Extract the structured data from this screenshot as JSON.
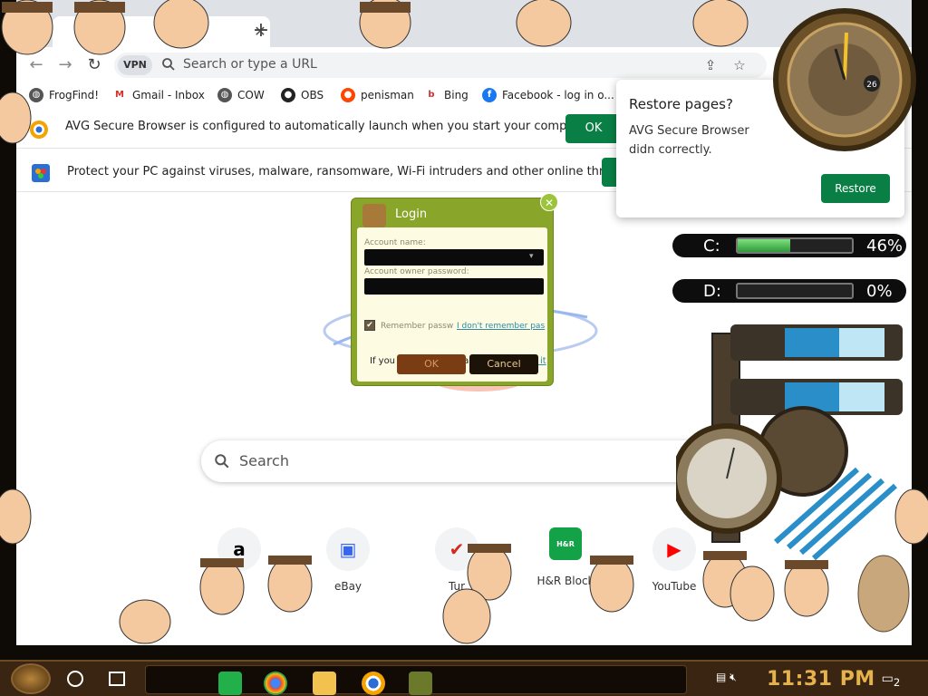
{
  "toolbar": {
    "vpn_label": "VPN",
    "omnibox_placeholder": "Search or type a URL"
  },
  "bookmarks": [
    {
      "label": "FrogFind!",
      "icon": "globe-icon"
    },
    {
      "label": "Gmail - Inbox",
      "icon": "gmail-icon"
    },
    {
      "label": "COW",
      "icon": "globe-icon"
    },
    {
      "label": "OBS",
      "icon": "github-icon"
    },
    {
      "label": "penisman",
      "icon": "reddit-icon"
    },
    {
      "label": "Bing",
      "icon": "bing-icon"
    },
    {
      "label": "Facebook - log in o...",
      "icon": "facebook-icon"
    }
  ],
  "infobars": [
    {
      "message": "AVG Secure Browser is configured to automatically launch when you start your computer.",
      "button": "OK"
    },
    {
      "message": "Protect your PC against viruses, malware, ransomware, Wi-Fi intruders and other online threats",
      "button": ""
    }
  ],
  "ntp": {
    "search_placeholder": "Search",
    "tiles": [
      {
        "name": "",
        "icon": "amazon-icon"
      },
      {
        "name": "eBay",
        "icon": "ebay-icon"
      },
      {
        "name": "Tur",
        "icon": "turbotax-icon"
      },
      {
        "name": "H&R Block",
        "icon": "hrblock-icon"
      },
      {
        "name": "YouTube",
        "icon": "youtube-icon"
      }
    ]
  },
  "restore_popup": {
    "title": "Restore pages?",
    "body": "AVG Secure Browser didn correctly.",
    "button": "Restore"
  },
  "login_dialog": {
    "title": "Login",
    "account_name_label": "Account name:",
    "password_label": "Account owner password:",
    "remember_label": "Remember passw",
    "forgot_link": "I don't remember pas",
    "no_account_text": "If you don't have an account -",
    "create_link": "create it",
    "ok_button": "OK",
    "cancel_button": "Cancel"
  },
  "drives": [
    {
      "letter": "C:",
      "percent_text": "46%",
      "fill_fraction": 0.46
    },
    {
      "letter": "D:",
      "percent_text": "0%",
      "fill_fraction": 0.0
    }
  ],
  "clock_widget": {
    "day": "26"
  },
  "taskbar": {
    "time": "11:31 PM",
    "notification_count": "2"
  },
  "colors": {
    "accent_green": "#0a7f45",
    "clock_gold": "#e6b24c"
  }
}
